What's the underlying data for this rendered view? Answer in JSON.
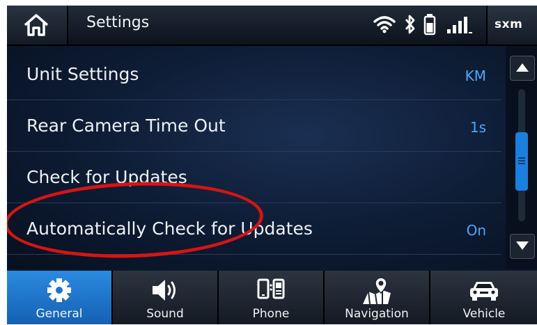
{
  "header": {
    "title": "Settings",
    "home_icon": "home-icon",
    "status_icons": [
      "wifi-icon",
      "bluetooth-icon",
      "battery-icon",
      "signal-icon"
    ],
    "sxm_label": "sxm"
  },
  "settings": {
    "rows": [
      {
        "label": "Unit Settings",
        "value": "KM"
      },
      {
        "label": "Rear Camera Time Out",
        "value": "1s"
      },
      {
        "label": "Check for Updates",
        "value": ""
      },
      {
        "label": "Automatically Check for Updates",
        "value": "On"
      }
    ]
  },
  "annotation": {
    "highlighted_item": "Check for Updates",
    "color": "#d61414"
  },
  "nav": {
    "tabs": [
      {
        "label": "General",
        "icon": "gear-icon",
        "active": true
      },
      {
        "label": "Sound",
        "icon": "speaker-icon",
        "active": false
      },
      {
        "label": "Phone",
        "icon": "phone-icon",
        "active": false
      },
      {
        "label": "Navigation",
        "icon": "map-pin-icon",
        "active": false
      },
      {
        "label": "Vehicle",
        "icon": "car-icon",
        "active": false
      }
    ]
  },
  "colors": {
    "accent": "#1b7fe0",
    "value_text": "#49a8ff",
    "active_tab": "#2c8ae0"
  }
}
